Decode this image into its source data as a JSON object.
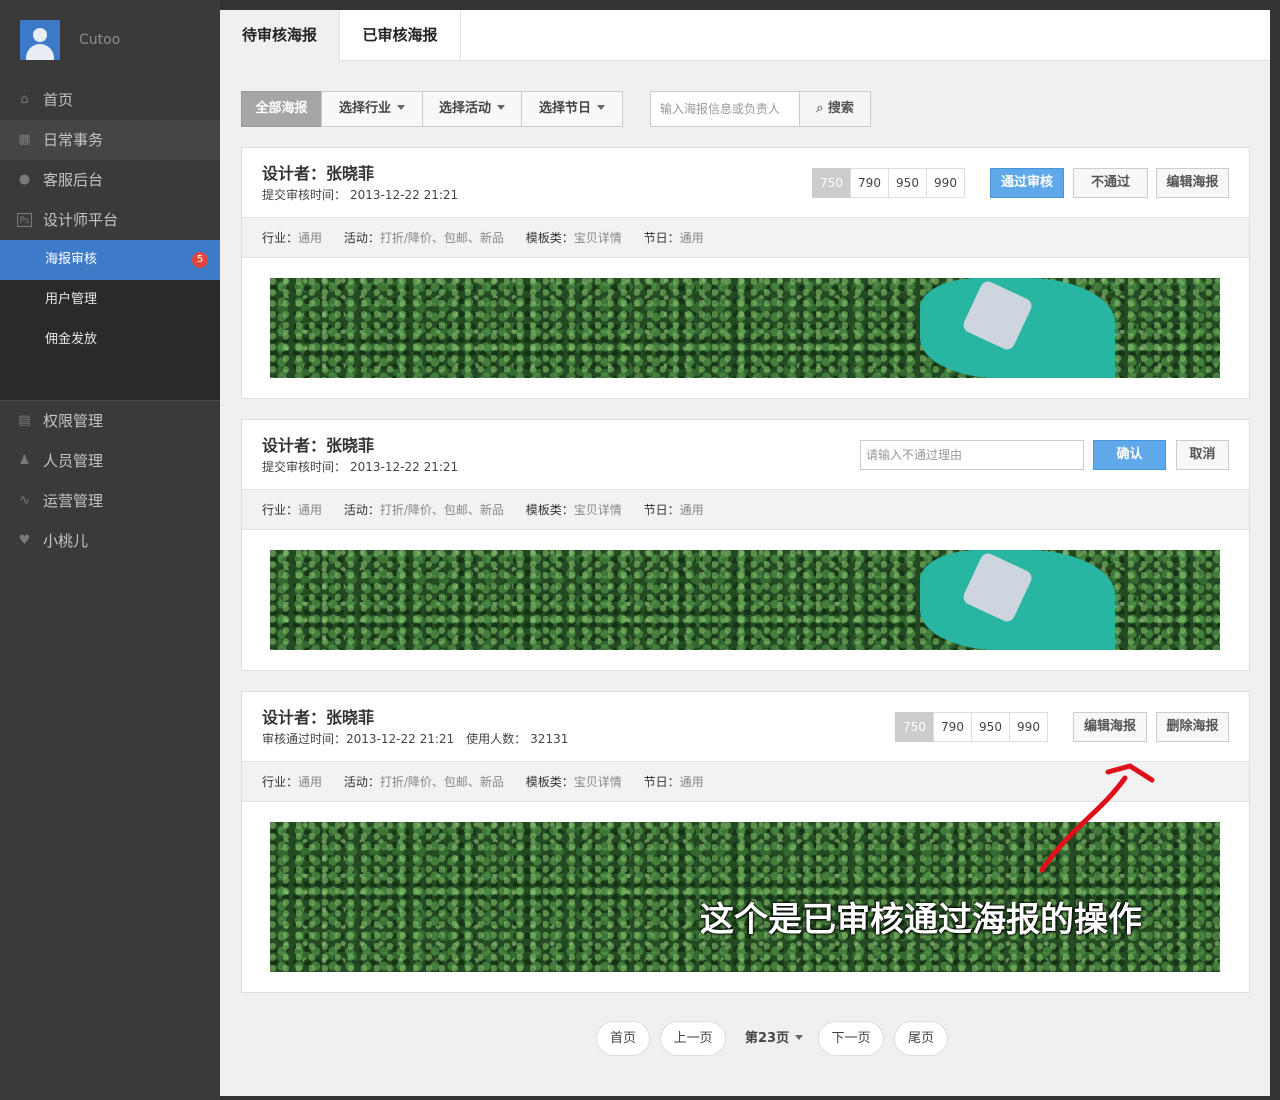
{
  "user": {
    "name": "Cutoo"
  },
  "sidebar": {
    "items": [
      {
        "label": "首页",
        "icon": "home-icon"
      },
      {
        "label": "日常事务",
        "icon": "calendar-icon"
      },
      {
        "label": "客服后台",
        "icon": "chat-icon"
      },
      {
        "label": "设计师平台",
        "icon": "ps-icon"
      }
    ],
    "sub_items": [
      {
        "label": "海报审核",
        "badge": "5"
      },
      {
        "label": "用户管理"
      },
      {
        "label": "佣金发放"
      }
    ],
    "items2": [
      {
        "label": "权限管理",
        "icon": "grid-icon"
      },
      {
        "label": "人员管理",
        "icon": "person-icon"
      },
      {
        "label": "运营管理",
        "icon": "pulse-icon"
      },
      {
        "label": "小桃儿",
        "icon": "heart-icon"
      }
    ]
  },
  "tabs": [
    "待审核海报",
    "已审核海报"
  ],
  "filters": {
    "all": "全部海报",
    "industry": "选择行业",
    "activity": "选择活动",
    "holiday": "选择节日",
    "search_placeholder": "输入海报信息或负责人",
    "search_button": "搜索"
  },
  "labels": {
    "designer_prefix": "设计者：",
    "submit_time": "提交审核时间：",
    "approved_time": "审核通过时间：",
    "users_count": "使用人数：",
    "industry": "行业：",
    "activity": "活动：",
    "template": "模板类：",
    "holiday": "节日："
  },
  "sizes": [
    "750",
    "790",
    "950",
    "990"
  ],
  "cards": [
    {
      "designer": "张晓菲",
      "time": "2013-12-22  21:21",
      "industry": "通用",
      "activity": "打折/降价、包邮、新品",
      "template": "宝贝详情",
      "holiday": "通用",
      "approve": "通过审核",
      "reject": "不通过",
      "edit": "编辑海报"
    },
    {
      "designer": "张晓菲",
      "time": "2013-12-22  21:21",
      "industry": "通用",
      "activity": "打折/降价、包邮、新品",
      "template": "宝贝详情",
      "holiday": "通用",
      "reason_placeholder": "请输入不通过理由",
      "confirm": "确认",
      "cancel": "取消"
    },
    {
      "designer": "张晓菲",
      "time": "2013-12-22 21:21",
      "users": "32131",
      "industry": "通用",
      "activity": "打折/降价、包邮、新品",
      "template": "宝贝详情",
      "holiday": "通用",
      "edit": "编辑海报",
      "delete": "删除海报"
    }
  ],
  "annotation": "这个是已审核通过海报的操作",
  "pagination": {
    "first": "首页",
    "prev": "上一页",
    "current": "第23页",
    "next": "下一页",
    "last": "尾页"
  },
  "colors": {
    "accent": "#3d7ac8",
    "primary_button": "#5fa8ea",
    "badge": "#e0473c",
    "annotation_arrow": "#e0101a"
  }
}
